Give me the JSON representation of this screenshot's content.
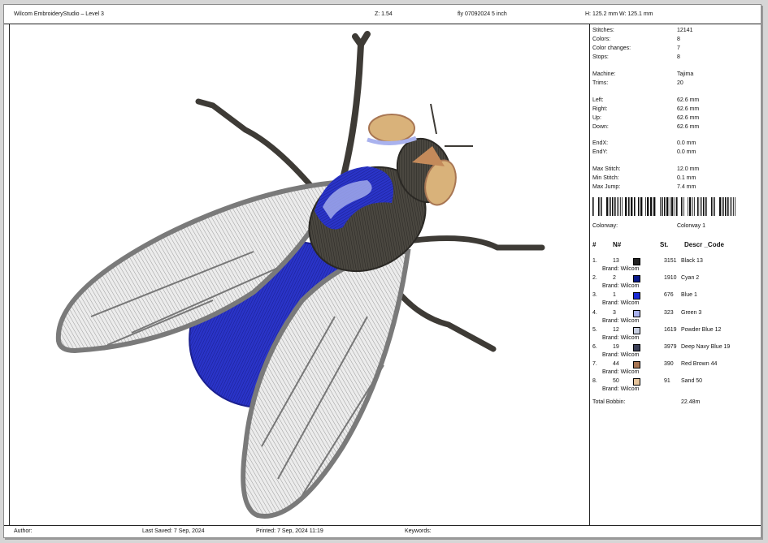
{
  "header": {
    "app_title": "Wilcom EmbroideryStudio – Level 3",
    "zoom": "Z: 1.54",
    "design_name": "fly 07092024 5 inch",
    "size": "H: 125.2 mm   W: 125.1 mm"
  },
  "stats": [
    {
      "label": "Stitches:",
      "value": "12141"
    },
    {
      "label": "Colors:",
      "value": "8"
    },
    {
      "label": "Color changes:",
      "value": "7"
    },
    {
      "label": "Stops:",
      "value": "8"
    },
    {
      "label": "Machine:",
      "value": "Tajima"
    },
    {
      "label": "Trims:",
      "value": "20"
    },
    {
      "label": "Left:",
      "value": "62.6 mm"
    },
    {
      "label": "Right:",
      "value": "62.6 mm"
    },
    {
      "label": "Up:",
      "value": "62.6 mm"
    },
    {
      "label": "Down:",
      "value": "62.6 mm"
    },
    {
      "label": "EndX:",
      "value": "0.0 mm"
    },
    {
      "label": "EndY:",
      "value": "0.0 mm"
    },
    {
      "label": "Max Stitch:",
      "value": "12.0 mm"
    },
    {
      "label": "Min Stitch:",
      "value": "0.1 mm"
    },
    {
      "label": "Max Jump:",
      "value": "7.4 mm"
    }
  ],
  "colorway": {
    "label": "Colorway:",
    "value": "Colorway 1"
  },
  "color_table": {
    "headers": {
      "index": "#",
      "n": "N#",
      "st": "St.",
      "descr": "Descr _Code"
    },
    "rows": [
      {
        "idx": "1.",
        "n": "13",
        "color": "#222222",
        "st": "3151",
        "descr": "Black 13",
        "brand": "Brand: Wilcom"
      },
      {
        "idx": "2.",
        "n": "2",
        "color": "#0a1a8a",
        "st": "1910",
        "descr": "Cyan 2",
        "brand": "Brand: Wilcom"
      },
      {
        "idx": "3.",
        "n": "1",
        "color": "#1a2bd6",
        "st": "676",
        "descr": "Blue 1",
        "brand": "Brand: Wilcom"
      },
      {
        "idx": "4.",
        "n": "3",
        "color": "#a9b2ee",
        "st": "323",
        "descr": "Green 3",
        "brand": "Brand: Wilcom"
      },
      {
        "idx": "5.",
        "n": "12",
        "color": "#c6cde0",
        "st": "1619",
        "descr": "Powder Blue 12",
        "brand": "Brand: Wilcom"
      },
      {
        "idx": "6.",
        "n": "19",
        "color": "#3b3f57",
        "st": "3979",
        "descr": "Deep Navy Blue 19",
        "brand": "Brand: Wilcom"
      },
      {
        "idx": "7.",
        "n": "44",
        "color": "#a87653",
        "st": "390",
        "descr": "Red Brown 44",
        "brand": "Brand: Wilcom"
      },
      {
        "idx": "8.",
        "n": "50",
        "color": "#e6c49b",
        "st": "91",
        "descr": "Sand 50",
        "brand": "Brand: Wilcom"
      }
    ]
  },
  "total_bobbin": {
    "label": "Total Bobbin:",
    "value": "22.48m"
  },
  "footer": {
    "author": "Author:",
    "last_saved": "Last Saved:  7 Sep, 2024",
    "printed": "Printed:  7 Sep, 2024 11:19",
    "keywords": "Keywords:"
  }
}
